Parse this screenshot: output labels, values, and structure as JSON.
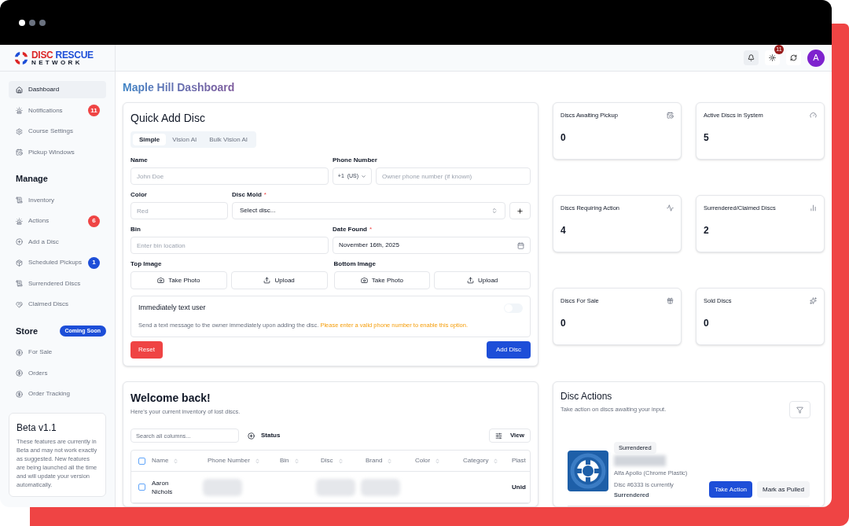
{
  "brand": {
    "words": [
      "DISC",
      "RESCUE"
    ],
    "subtitle": "NETWORK"
  },
  "sidebar": {
    "sections": [
      {
        "items": [
          {
            "label": "Dashboard",
            "selected": true
          },
          {
            "label": "Notifications",
            "selected": false,
            "badge": "11",
            "color": "#ef4444"
          },
          {
            "label": "Course Settings",
            "selected": false
          },
          {
            "label": "Pickup Windows",
            "selected": false
          }
        ]
      },
      {
        "title": "Manage",
        "items": [
          {
            "label": "Inventory",
            "selected": false
          },
          {
            "label": "Actions",
            "selected": false,
            "badge": "6",
            "color": "#ef4444"
          },
          {
            "label": "Add a Disc",
            "selected": false
          },
          {
            "label": "Scheduled Pickups",
            "selected": false,
            "badge": "1",
            "color": "#1d4ed8"
          },
          {
            "label": "Surrendered Discs",
            "selected": false
          },
          {
            "label": "Claimed Discs",
            "selected": false
          }
        ]
      },
      {
        "title": "Store",
        "tag": "Coming Soon",
        "items": [
          {
            "label": "For Sale",
            "selected": false
          },
          {
            "label": "Orders",
            "selected": false
          },
          {
            "label": "Order Tracking",
            "selected": false
          }
        ]
      }
    ],
    "beta": {
      "title": "Beta v1.1",
      "text": "These features are currently in Beta and may not work exactly as suggested. New features are being launched all the time and will update your version automatically."
    }
  },
  "header": {
    "theme_badge": "11",
    "avatar": "A"
  },
  "page_title": "Maple Hill Dashboard",
  "quick_add": {
    "title": "Quick Add Disc",
    "tabs": [
      {
        "label": "Simple",
        "selected": true
      },
      {
        "label": "Vision AI",
        "selected": false
      },
      {
        "label": "Bulk Vision AI",
        "selected": false
      }
    ],
    "name": {
      "label": "Name",
      "placeholder": "John Doe"
    },
    "phone": {
      "label": "Phone Number",
      "country": "+1  (US)",
      "placeholder": "Owner phone number (if known)"
    },
    "color": {
      "label": "Color",
      "placeholder": "Red"
    },
    "disc_mold": {
      "label": "Disc Mold",
      "required_mark": "*",
      "value": "Select disc..."
    },
    "bin": {
      "label": "Bin",
      "placeholder": "Enter bin location"
    },
    "date_found": {
      "label": "Date Found",
      "required_mark": "*",
      "value": "November 16th, 2025"
    },
    "images": [
      {
        "label": "Top Image",
        "buttons": [
          "Take Photo",
          "Upload"
        ]
      },
      {
        "label": "Bottom Image",
        "buttons": [
          "Take Photo",
          "Upload"
        ]
      }
    ],
    "text_user": {
      "title": "Immediately text user",
      "on": false,
      "description": "Send a text message to the owner immediately upon adding the disc.",
      "warning": "Please enter a valid phone number to enable this option."
    },
    "reset": "Reset",
    "submit": "Add Disc"
  },
  "stats": [
    {
      "label": "Discs Awaiting Pickup",
      "value": "0"
    },
    {
      "label": "Active Discs in System",
      "value": "5"
    },
    {
      "label": "Discs Requiring Action",
      "value": "4"
    },
    {
      "label": "Surrendered/Claimed Discs",
      "value": "2"
    },
    {
      "label": "Discs For Sale",
      "value": "0"
    },
    {
      "label": "Sold Discs",
      "value": "0"
    }
  ],
  "inventory": {
    "title": "Welcome back!",
    "subtitle": "Here's your current inventory of lost discs.",
    "search_placeholder": "Search all columns...",
    "status_filter": "Status",
    "view": "View",
    "select_all_checked": false,
    "columns": [
      "Name",
      "Phone Number",
      "Bin",
      "Disc",
      "Brand",
      "Color",
      "Category",
      "Plast"
    ],
    "rows": [
      {
        "checked": false,
        "cells": [
          {
            "kind": "text",
            "text": "Aaron Nichols"
          },
          {
            "kind": "blurred"
          },
          {
            "kind": "empty"
          },
          {
            "kind": "blurred"
          },
          {
            "kind": "blurred"
          },
          {
            "kind": "empty"
          },
          {
            "kind": "empty"
          },
          {
            "kind": "bold",
            "text": "Unid"
          }
        ]
      }
    ]
  },
  "disc_actions": {
    "title": "Disc Actions",
    "subtitle": "Take action on discs awaiting your input.",
    "items": [
      {
        "kind": "picture",
        "status": "Surrendered",
        "model": "Alfa Apollo (Chrome Plastic)",
        "note": "Disc #6333 is currently",
        "state": "Surrendered",
        "buttons": [
          "Take Action",
          "Mark as Pulled"
        ]
      }
    ]
  }
}
